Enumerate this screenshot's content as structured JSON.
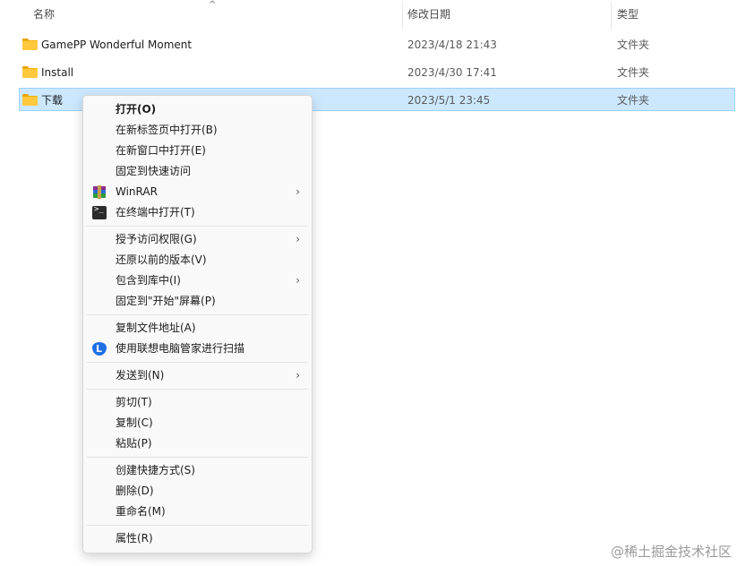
{
  "header": {
    "name": "名称",
    "date": "修改日期",
    "type": "类型",
    "sort_arrow": "^"
  },
  "files": [
    {
      "name": "GamePP Wonderful Moment",
      "date": "2023/4/18 21:43",
      "type": "文件夹",
      "icon": "folder-icon",
      "selected": false
    },
    {
      "name": "Install",
      "date": "2023/4/30 17:41",
      "type": "文件夹",
      "icon": "folder-icon",
      "selected": false
    },
    {
      "name": "下载",
      "date": "2023/5/1 23:45",
      "type": "文件夹",
      "icon": "folder-icon",
      "selected": true
    }
  ],
  "context_menu": {
    "groups": [
      [
        {
          "label": "打开(O)",
          "bold": true
        },
        {
          "label": "在新标签页中打开(B)"
        },
        {
          "label": "在新窗口中打开(E)"
        },
        {
          "label": "固定到快速访问"
        },
        {
          "label": "WinRAR",
          "icon": "winrar-icon",
          "submenu": true
        },
        {
          "label": "在终端中打开(T)",
          "icon": "terminal-icon"
        }
      ],
      [
        {
          "label": "授予访问权限(G)",
          "submenu": true
        },
        {
          "label": "还原以前的版本(V)"
        },
        {
          "label": "包含到库中(I)",
          "submenu": true
        },
        {
          "label": "固定到\"开始\"屏幕(P)"
        }
      ],
      [
        {
          "label": "复制文件地址(A)"
        },
        {
          "label": "使用联想电脑管家进行扫描",
          "icon": "lenovo-shield-icon"
        }
      ],
      [
        {
          "label": "发送到(N)",
          "submenu": true
        }
      ],
      [
        {
          "label": "剪切(T)"
        },
        {
          "label": "复制(C)"
        },
        {
          "label": "粘贴(P)"
        }
      ],
      [
        {
          "label": "创建快捷方式(S)"
        },
        {
          "label": "删除(D)"
        },
        {
          "label": "重命名(M)"
        }
      ],
      [
        {
          "label": "属性(R)"
        }
      ]
    ],
    "submenu_arrow": "›",
    "terminal_glyph": ">_",
    "shield_glyph": "L"
  },
  "watermark": "@稀土掘金技术社区",
  "colors": {
    "selection_bg": "#cce8ff",
    "selection_border": "#99d1ff",
    "folder": "#ffc83d"
  }
}
